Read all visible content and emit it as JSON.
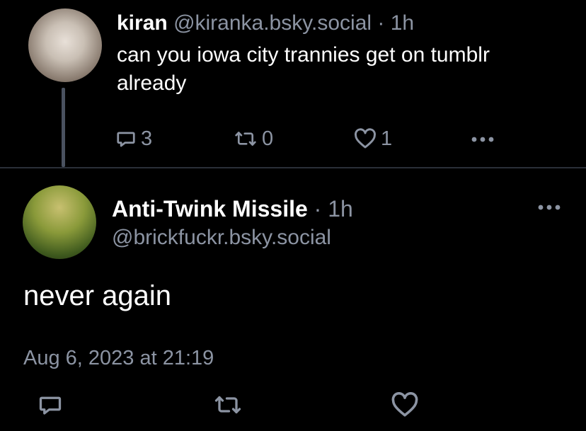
{
  "parent_post": {
    "author_name": "kiran",
    "author_handle": "@kiranka.bsky.social",
    "separator": "·",
    "time_ago": "1h",
    "text": "can you iowa city trannies get on tumblr already",
    "reply_count": "3",
    "repost_count": "0",
    "like_count": "1"
  },
  "main_post": {
    "author_name": "Anti-Twink Missile",
    "separator": "·",
    "time_ago": "1h",
    "author_handle": "@brickfuckr.bsky.social",
    "text": "never again",
    "timestamp": "Aug 6, 2023 at 21:19"
  },
  "icons": {
    "reply": "speech-bubble-icon",
    "repost": "repost-arrows-icon",
    "like": "heart-icon",
    "more": "more-dots-icon"
  },
  "colors": {
    "background": "#000000",
    "primary_text": "#ffffff",
    "muted_text": "#8c94a3",
    "thread_line": "#4a5260",
    "divider": "#2a2f38"
  }
}
